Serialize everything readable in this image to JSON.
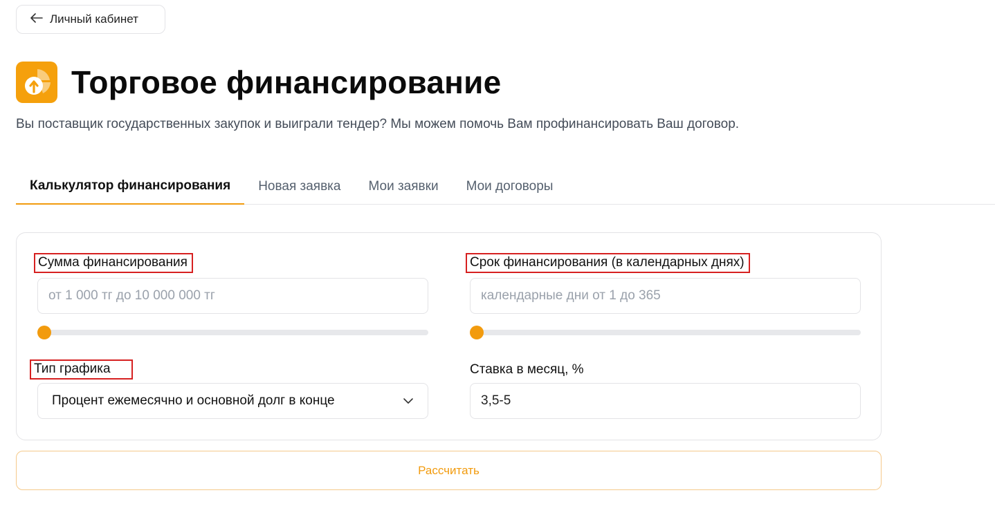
{
  "back_button": {
    "label": "Личный кабинет"
  },
  "header": {
    "title": "Торговое финансирование",
    "subtitle": "Вы поставщик государственных закупок и выиграли тендер? Мы можем помочь Вам профинансировать Ваш договор."
  },
  "tabs": [
    {
      "label": "Калькулятор финансирования",
      "active": true
    },
    {
      "label": "Новая заявка",
      "active": false
    },
    {
      "label": "Мои заявки",
      "active": false
    },
    {
      "label": "Мои договоры",
      "active": false
    }
  ],
  "calculator": {
    "amount": {
      "label": "Сумма финансирования",
      "placeholder": "от 1 000 тг до 10 000 000 тг",
      "value": "",
      "slider_level": 0
    },
    "term": {
      "label": "Срок финансирования (в календарных днях)",
      "placeholder": "календарные дни от 1 до 365",
      "value": "",
      "slider_level": 0
    },
    "schedule": {
      "label": "Тип графика",
      "selected": "Процент ежемесячно и основной долг в конце"
    },
    "rate": {
      "label": "Ставка в месяц, %",
      "value": "3,5-5"
    }
  },
  "calculate_button": {
    "label": "Рассчитать"
  },
  "colors": {
    "accent": "#f29b0e",
    "icon_bg": "#f5a00c",
    "highlight_box": "#d62020"
  }
}
